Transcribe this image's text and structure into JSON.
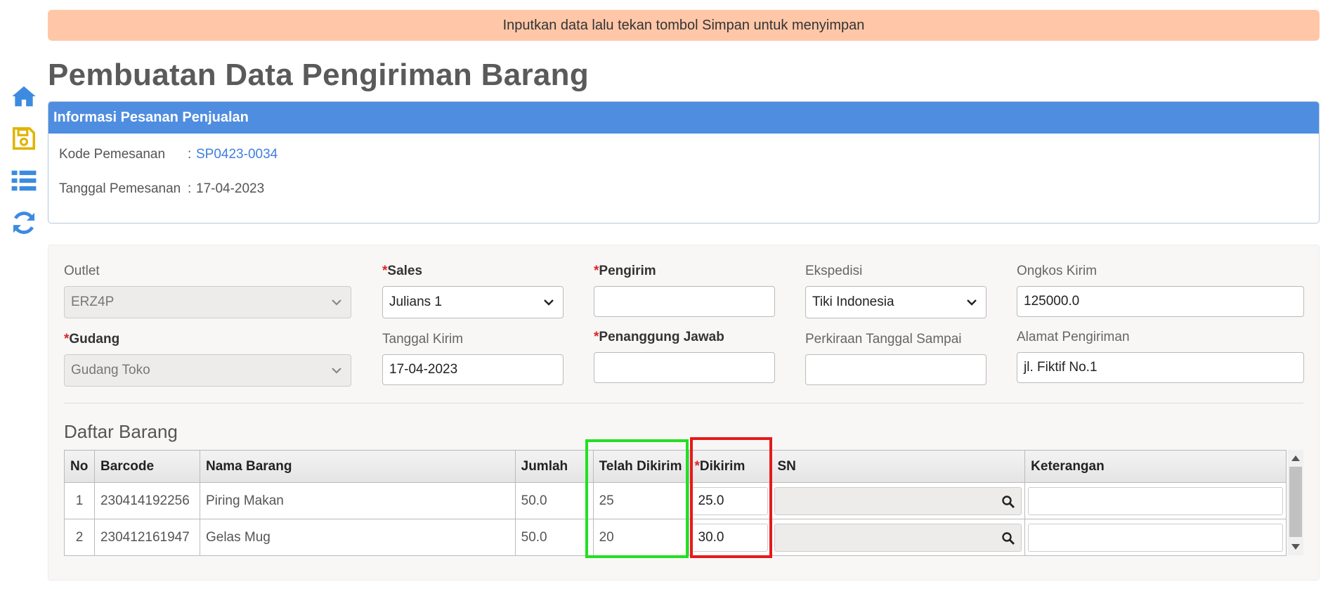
{
  "banner": {
    "message": "Inputkan data lalu tekan tombol Simpan untuk menyimpan"
  },
  "sidebar": {
    "icons": [
      "home-icon",
      "save-icon",
      "list-icon",
      "refresh-icon"
    ]
  },
  "page": {
    "title": "Pembuatan Data Pengiriman Barang"
  },
  "order_info": {
    "header": "Informasi Pesanan Penjualan",
    "order_code_label": "Kode Pemesanan",
    "order_code_sep": ":",
    "order_code_value": "SP0423-0034",
    "order_date_label": "Tanggal Pemesanan",
    "order_date_sep": ":",
    "order_date_value": "17-04-2023"
  },
  "form": {
    "outlet": {
      "label": "Outlet",
      "value": "ERZ4P"
    },
    "sales": {
      "star": "*",
      "label": "Sales",
      "value": "Julians 1"
    },
    "pengirim": {
      "star": "*",
      "label": "Pengirim",
      "value": ""
    },
    "ekspedisi": {
      "label": "Ekspedisi",
      "value": "Tiki Indonesia"
    },
    "ongkos_kirim": {
      "label": "Ongkos Kirim",
      "value": "125000.0"
    },
    "gudang": {
      "star": "*",
      "label": "Gudang",
      "value": "Gudang Toko"
    },
    "tanggal_kirim": {
      "label": "Tanggal Kirim",
      "value": "17-04-2023"
    },
    "penanggung_jawab": {
      "star": "*",
      "label": "Penanggung Jawab",
      "value": ""
    },
    "perkiraan_tanggal": {
      "label": "Perkiraan Tanggal Sampai",
      "value": ""
    },
    "alamat": {
      "label": "Alamat Pengiriman",
      "value": "jl. Fiktif No.1"
    }
  },
  "items": {
    "title": "Daftar Barang",
    "columns": {
      "no": "No",
      "barcode": "Barcode",
      "nama": "Nama Barang",
      "jumlah": "Jumlah",
      "telah": "Telah Dikirim",
      "dikirim_star": "*",
      "dikirim": "Dikirim",
      "sn": "SN",
      "keterangan": "Keterangan"
    },
    "rows": [
      {
        "no": "1",
        "barcode": "230414192256",
        "nama": "Piring Makan",
        "jumlah": "50.0",
        "telah": "25",
        "dikirim": "25.0",
        "sn": "",
        "keterangan": ""
      },
      {
        "no": "2",
        "barcode": "230412161947",
        "nama": "Gelas Mug",
        "jumlah": "50.0",
        "telah": "20",
        "dikirim": "30.0",
        "sn": "",
        "keterangan": ""
      }
    ]
  },
  "colors": {
    "accent": "#4f8de0",
    "banner": "#ffc7a8",
    "required": "#e02424",
    "highlight_green": "#22e022",
    "highlight_red": "#e51a1a"
  }
}
